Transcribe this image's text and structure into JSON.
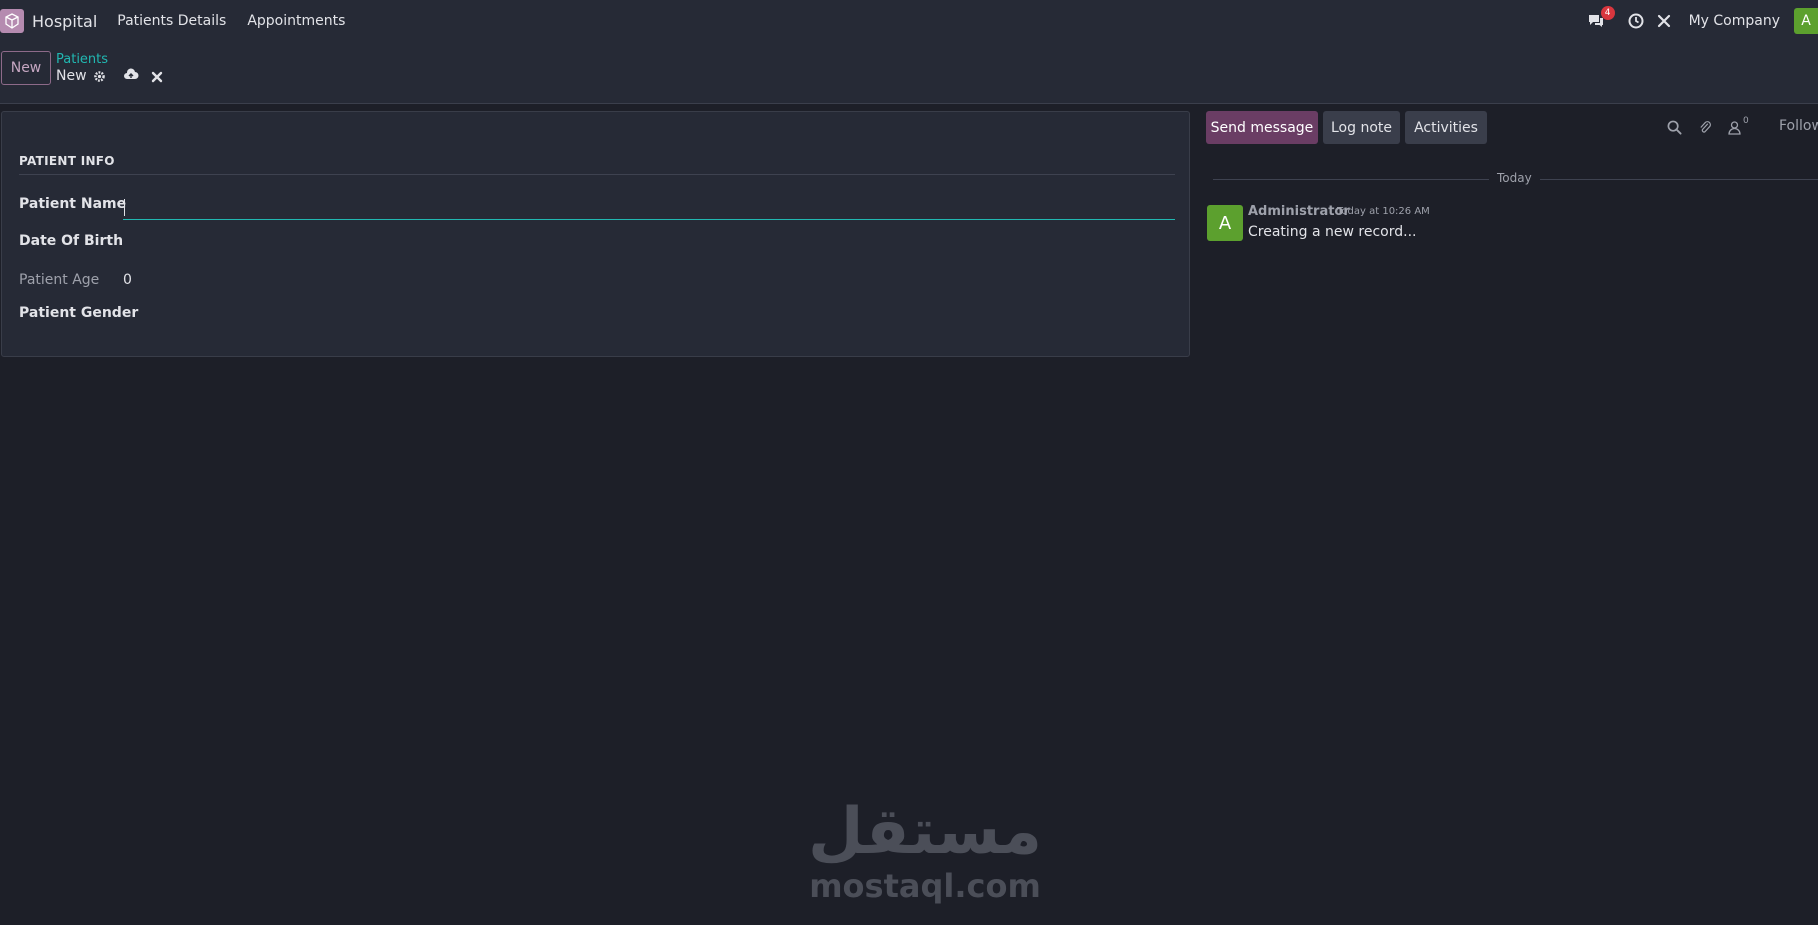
{
  "navbar": {
    "app_name": "Hospital",
    "menus": [
      "Patients Details",
      "Appointments"
    ],
    "messages_badge": "4",
    "company": "My Company",
    "user_initial": "A"
  },
  "control_panel": {
    "new_button": "New",
    "breadcrumb_parent": "Patients",
    "breadcrumb_current": "New"
  },
  "form": {
    "section_title": "PATIENT INFO",
    "fields": {
      "patient_name_label": "Patient Name",
      "patient_name_value": "",
      "date_of_birth_label": "Date Of Birth",
      "patient_age_label": "Patient Age",
      "patient_age_value": "0",
      "patient_gender_label": "Patient Gender"
    }
  },
  "chatter": {
    "send_message": "Send message",
    "log_note": "Log note",
    "activities": "Activities",
    "followers_count": "0",
    "follow_label": "Follow",
    "date_separator": "Today",
    "messages": [
      {
        "avatar_initial": "A",
        "author": "Administrator",
        "date": "Today at 10:26 AM",
        "body": "Creating a new record..."
      }
    ]
  },
  "watermark": {
    "arabic": "مستقل",
    "latin": "mostaql.com"
  },
  "colors": {
    "background": "#1d1f28",
    "panel": "#262a36",
    "accent_teal": "#21b7b1",
    "primary_button": "#6a3d64",
    "avatar_green": "#5ca02e",
    "badge_red": "#d9363e"
  }
}
